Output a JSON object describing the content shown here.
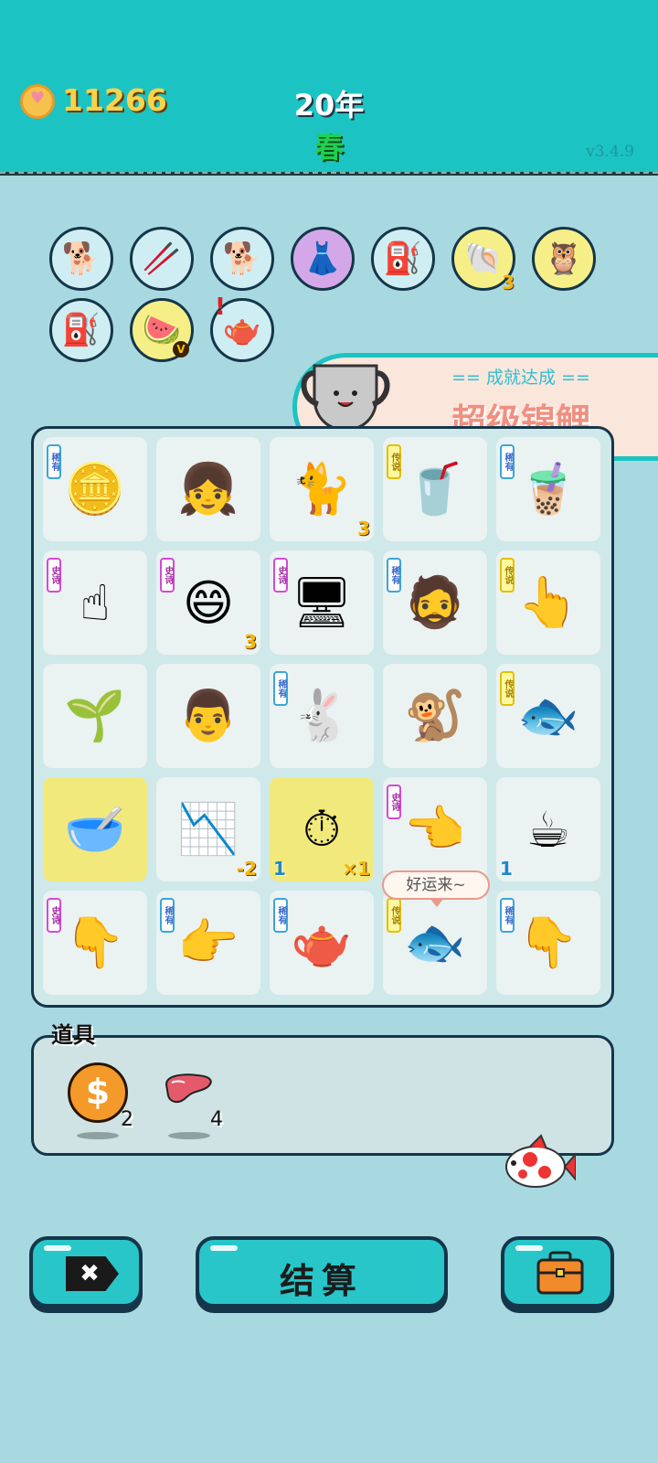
{
  "header": {
    "coins": "11266",
    "year": "20年",
    "season": "春",
    "version": "v3.4.9"
  },
  "owned_items": [
    {
      "icon": "husky-dog",
      "glyph": "🐕"
    },
    {
      "icon": "chopsticks",
      "glyph": "🥢"
    },
    {
      "icon": "husky-dog",
      "glyph": "🐕"
    },
    {
      "icon": "pleated-skirt",
      "glyph": "👗"
    },
    {
      "icon": "air-pump",
      "glyph": "⛽"
    },
    {
      "icon": "scallop-shell",
      "glyph": "🐚",
      "count": "3"
    },
    {
      "icon": "owls",
      "glyph": "🦉"
    },
    {
      "icon": "air-pump",
      "glyph": "⛽"
    },
    {
      "icon": "fruit-platter",
      "glyph": "🍉",
      "badge": "V"
    },
    {
      "icon": "gravy-boat",
      "glyph": "🫖",
      "alert": "!"
    }
  ],
  "achievement": {
    "subtitle": "== 成就达成 ==",
    "title": "超级锦鲤"
  },
  "board": {
    "speech_bubble": "好运来~",
    "tiles": [
      {
        "icon": "gold-pentagon",
        "glyph": "🪙",
        "tag": "稀有",
        "tag_color": "blue"
      },
      {
        "icon": "girl-portrait",
        "glyph": "👧"
      },
      {
        "icon": "cat",
        "glyph": "🐈",
        "count": "3"
      },
      {
        "icon": "bubble-tea-cup",
        "glyph": "🥤",
        "tag": "传说",
        "tag_color": "yel"
      },
      {
        "icon": "bubble-tea",
        "glyph": "🧋",
        "tag": "稀有",
        "tag_color": "blue"
      },
      {
        "icon": "pointing-hand-gray",
        "glyph": "☝",
        "tag": "史诗",
        "tag_color": "pink"
      },
      {
        "icon": "yellow-face",
        "glyph": "😄",
        "tag": "史诗",
        "tag_color": "pink",
        "count": "3"
      },
      {
        "icon": "graphics-card",
        "glyph": "🖥",
        "tag": "史诗",
        "tag_color": "pink"
      },
      {
        "icon": "man-with-hat",
        "glyph": "🧔",
        "tag": "稀有",
        "tag_color": "blue"
      },
      {
        "icon": "pointing-hand-gold",
        "glyph": "👆",
        "tag": "传说",
        "tag_color": "yel"
      },
      {
        "icon": "sprout",
        "glyph": "🌱"
      },
      {
        "icon": "man-face",
        "glyph": "👨"
      },
      {
        "icon": "rabbit",
        "glyph": "🐇",
        "tag": "稀有",
        "tag_color": "blue"
      },
      {
        "icon": "monkey",
        "glyph": "🐒"
      },
      {
        "icon": "koi-fish",
        "glyph": "🐟",
        "tag": "传说",
        "tag_color": "yel"
      },
      {
        "icon": "soup-bowl-removed",
        "glyph": "🥣",
        "gold": true
      },
      {
        "icon": "falling-chart",
        "glyph": "📉",
        "count": "-2"
      },
      {
        "icon": "stopwatch-removed",
        "glyph": "⏱",
        "gold": true,
        "count": "×1",
        "count_left": "1"
      },
      {
        "icon": "pointing-hand-left",
        "glyph": "👈",
        "tag": "史诗",
        "tag_color": "pink"
      },
      {
        "icon": "coffee-cup",
        "glyph": "☕",
        "count_left": "1"
      },
      {
        "icon": "pointing-hand-down",
        "glyph": "👇",
        "tag": "史诗",
        "tag_color": "pink"
      },
      {
        "icon": "brown-pointing-hand",
        "glyph": "👉",
        "tag": "稀有",
        "tag_color": "blue"
      },
      {
        "icon": "teapot",
        "glyph": "🫖",
        "tag": "稀有",
        "tag_color": "blue"
      },
      {
        "icon": "koi-fish",
        "glyph": "🐟",
        "tag": "传说",
        "tag_color": "yel"
      },
      {
        "icon": "brown-hand-down",
        "glyph": "👇",
        "tag": "稀有",
        "tag_color": "blue"
      }
    ]
  },
  "props": {
    "label": "道具",
    "coin_symbol": "$",
    "coin_count": "2",
    "liver_count": "4"
  },
  "buttons": {
    "close_symbol": "✖",
    "settle": "结算"
  }
}
